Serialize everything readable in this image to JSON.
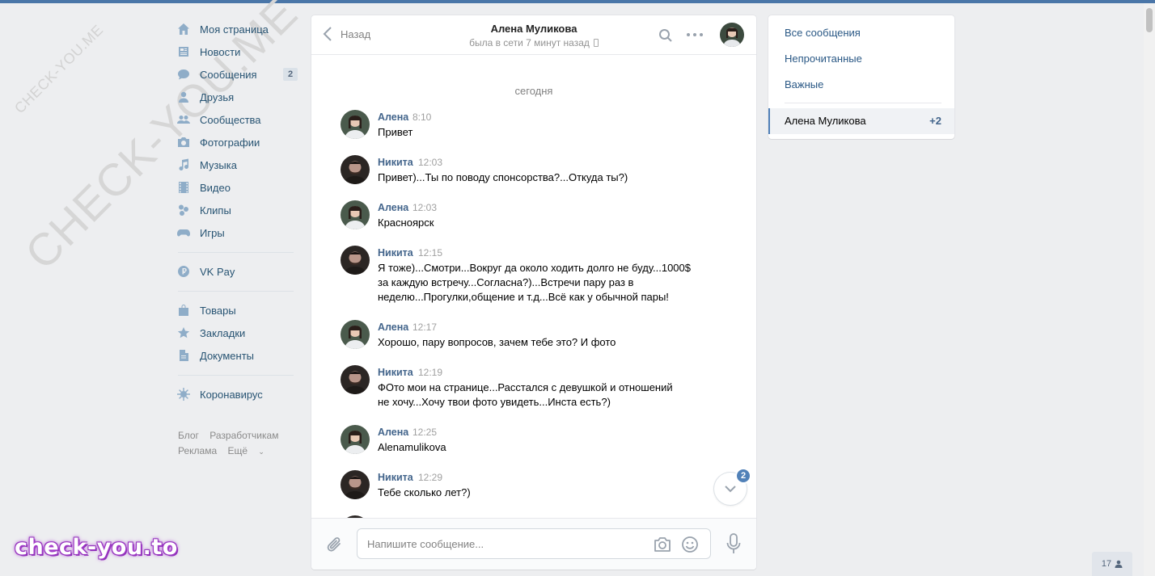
{
  "watermark": {
    "small": "CHECK-YOU.ME",
    "big": "CHECK-YOU.ME",
    "brand": "check-you.to"
  },
  "nav": {
    "items": [
      {
        "label": "Моя страница",
        "icon": "home-icon"
      },
      {
        "label": "Новости",
        "icon": "news-icon"
      },
      {
        "label": "Сообщения",
        "icon": "messages-icon",
        "badge": "2"
      },
      {
        "label": "Друзья",
        "icon": "friends-icon"
      },
      {
        "label": "Сообщества",
        "icon": "communities-icon"
      },
      {
        "label": "Фотографии",
        "icon": "camera-icon"
      },
      {
        "label": "Музыка",
        "icon": "music-note-icon"
      },
      {
        "label": "Видео",
        "icon": "film-icon"
      },
      {
        "label": "Клипы",
        "icon": "clips-icon"
      },
      {
        "label": "Игры",
        "icon": "gamepad-icon"
      }
    ],
    "pay": {
      "label": "VK Pay",
      "icon": "ruble-coin-icon"
    },
    "shop": [
      {
        "label": "Товары",
        "icon": "shopping-bag-icon"
      },
      {
        "label": "Закладки",
        "icon": "star-icon"
      },
      {
        "label": "Документы",
        "icon": "document-icon"
      }
    ],
    "covid": {
      "label": "Коронавирус",
      "icon": "virus-icon"
    },
    "footer": {
      "blog": "Блог",
      "dev": "Разработчикам",
      "ads": "Реклама",
      "more": "Ещё"
    }
  },
  "chat": {
    "back_label": "Назад",
    "title": "Алена Муликова",
    "status": "была в сети 7 минут назад",
    "date_separator": "сегодня",
    "messages": [
      {
        "author": "Алена",
        "time": "8:10",
        "text": "Привет"
      },
      {
        "author": "Никита",
        "time": "12:03",
        "text": "Привет)...Ты по поводу спонсорства?...Откуда ты?)"
      },
      {
        "author": "Алена",
        "time": "12:03",
        "text": "Красноярск"
      },
      {
        "author": "Никита",
        "time": "12:15",
        "text": "Я тоже)...Смотри...Вокруг да около ходить долго не буду...1000$ за каждую встречу...Согласна?)...Встречи пару раз в неделю...Прогулки,общение и т.д...Всё как у обычной пары!"
      },
      {
        "author": "Алена",
        "time": "12:17",
        "text": "Хорошо, пару вопросов, зачем тебе это? И фото"
      },
      {
        "author": "Никита",
        "time": "12:19",
        "text": "ФОто мои на странице...Расстался с девушкой и отношений не хочу...Хочу твои фото увидеть...Инста есть?)"
      },
      {
        "author": "Алена",
        "time": "12:25",
        "text": "Alenamulikova"
      },
      {
        "author": "Никита",
        "time": "12:29",
        "text": "Тебе сколько лет?)"
      }
    ],
    "unread_count": "2",
    "compose_placeholder": "Напишите сообщение..."
  },
  "right_panel": {
    "all": "Все сообщения",
    "unread": "Непрочитанные",
    "important": "Важные",
    "active_chat": "Алена Муликова",
    "active_count": "+2"
  },
  "online_count": "17",
  "colors": {
    "accent": "#4a76a8",
    "link": "#2a5885",
    "author": "#42648b"
  }
}
